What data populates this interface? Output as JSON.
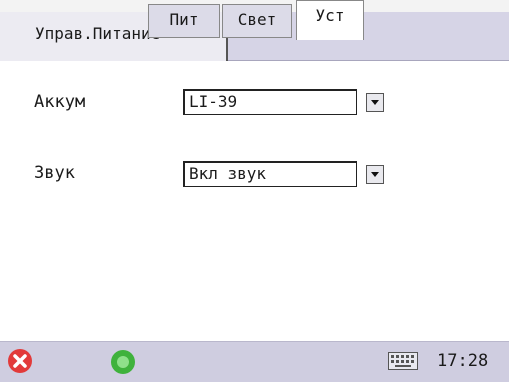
{
  "header": {
    "tab_label": "Управ.Питание"
  },
  "form": {
    "battery": {
      "label": "Аккум",
      "value": "LI-39"
    },
    "sound": {
      "label": "Звук",
      "value": "Вкл звук"
    }
  },
  "taskbar": {
    "tabs": [
      {
        "label": "Пит"
      },
      {
        "label": "Свет"
      },
      {
        "label": "Уст"
      }
    ],
    "clock": "17:28",
    "close_color": "#e23a3a",
    "ok_color": "#3fb23c"
  }
}
